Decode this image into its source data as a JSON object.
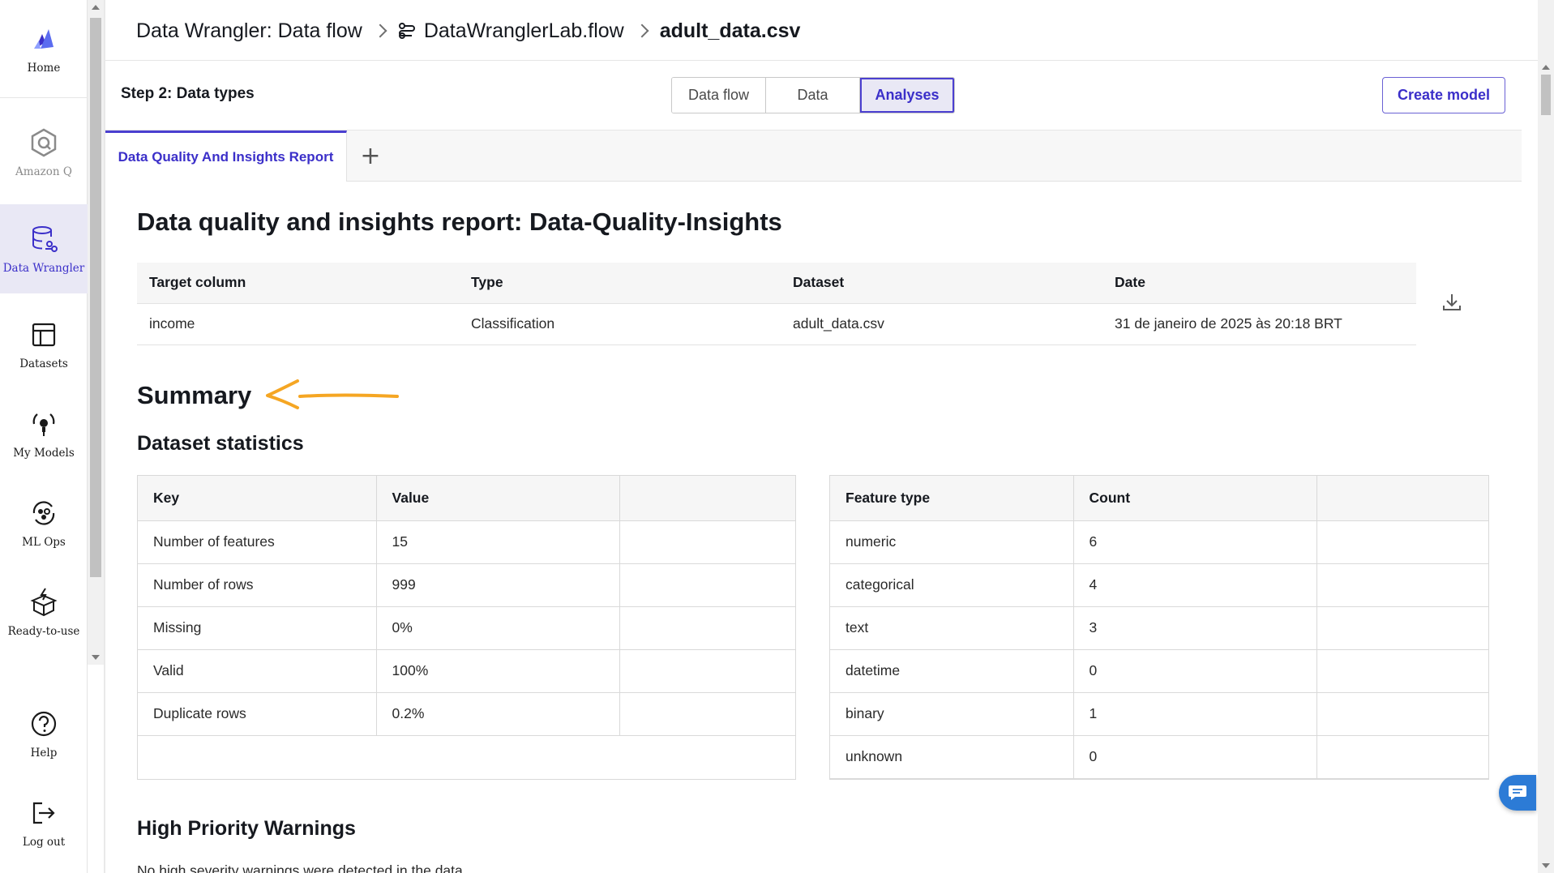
{
  "sidebar": {
    "items": [
      {
        "label": "Home",
        "icon": "logo-icon"
      },
      {
        "label": "Amazon Q",
        "icon": "amazon-q-icon"
      },
      {
        "label": "Data Wrangler",
        "icon": "data-wrangler-icon"
      },
      {
        "label": "Datasets",
        "icon": "table-icon"
      },
      {
        "label": "My Models",
        "icon": "bulb-icon"
      },
      {
        "label": "ML Ops",
        "icon": "ml-ops-icon"
      },
      {
        "label": "Ready-to-use",
        "icon": "box-icon"
      },
      {
        "label": "Help",
        "icon": "help-icon"
      },
      {
        "label": "Log out",
        "icon": "logout-icon"
      }
    ]
  },
  "breadcrumb": {
    "items": [
      "Data Wrangler: Data flow",
      "DataWranglerLab.flow",
      "adult_data.csv"
    ]
  },
  "step": {
    "title": "Step 2: Data types"
  },
  "view_tabs": [
    "Data flow",
    "Data",
    "Analyses"
  ],
  "active_view_tab": "Analyses",
  "create_model_label": "Create model",
  "report_tab": {
    "label": "Data Quality And Insights Report",
    "add_label": "+"
  },
  "report": {
    "title": "Data quality and insights report: Data-Quality-Insights",
    "meta": {
      "headers": [
        "Target column",
        "Type",
        "Dataset",
        "Date"
      ],
      "row": [
        "income",
        "Classification",
        "adult_data.csv",
        "31 de janeiro de 2025 às 20:18 BRT"
      ]
    },
    "summary_title": "Summary",
    "stats_title": "Dataset statistics",
    "key_value": {
      "headers": [
        "Key",
        "Value"
      ],
      "rows": [
        [
          "Number of features",
          "15"
        ],
        [
          "Number of rows",
          "999"
        ],
        [
          "Missing",
          "0%"
        ],
        [
          "Valid",
          "100%"
        ],
        [
          "Duplicate rows",
          "0.2%"
        ]
      ]
    },
    "feature_types": {
      "headers": [
        "Feature type",
        "Count"
      ],
      "rows": [
        [
          "numeric",
          "6"
        ],
        [
          "categorical",
          "4"
        ],
        [
          "text",
          "3"
        ],
        [
          "datetime",
          "0"
        ],
        [
          "binary",
          "1"
        ],
        [
          "unknown",
          "0"
        ]
      ]
    },
    "warnings_title": "High Priority Warnings",
    "warnings_text": "No high severity warnings were detected in the data."
  },
  "colors": {
    "accent": "#3b2fc9",
    "annotation": "#f5a623",
    "chat": "#2c7bd6"
  }
}
